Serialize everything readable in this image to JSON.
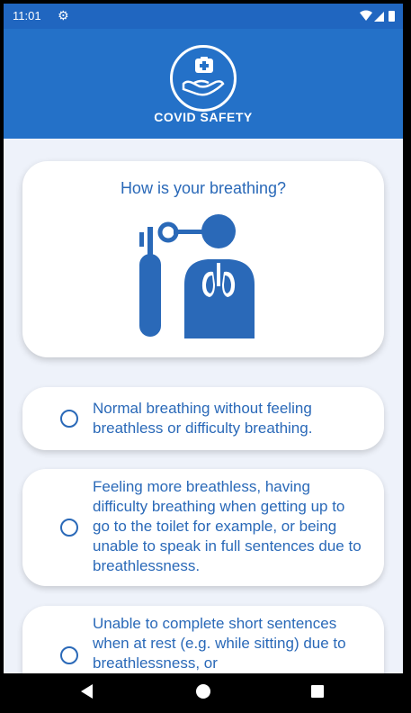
{
  "status_bar": {
    "time": "11:01",
    "icons": [
      "gear-icon",
      "wifi-icon",
      "signal-icon",
      "battery-icon"
    ]
  },
  "header": {
    "title": "COVID SAFETY",
    "logo_icon": "medical-hand-icon"
  },
  "question": {
    "text": "How is your breathing?",
    "illustration": "oxygen-breathing-icon"
  },
  "options": [
    {
      "label": "Normal breathing without feeling breathless or difficulty breathing.",
      "selected": false
    },
    {
      "label": "Feeling more breathless, having difficulty breathing when getting up to go to the toilet for example, or being unable to speak in full sentences due to breathlessness.",
      "selected": false
    },
    {
      "label": "Unable to complete short sentences when at rest (e.g. while sitting) due to breathlessness, or",
      "selected": false
    }
  ],
  "nav_bar": {
    "icons": [
      "back-icon",
      "home-icon",
      "recents-icon"
    ]
  },
  "colors": {
    "primary": "#2471c8",
    "status_bar": "#2066c0",
    "accent_text": "#2a69b8",
    "background": "#eef2fa",
    "card": "#ffffff"
  }
}
